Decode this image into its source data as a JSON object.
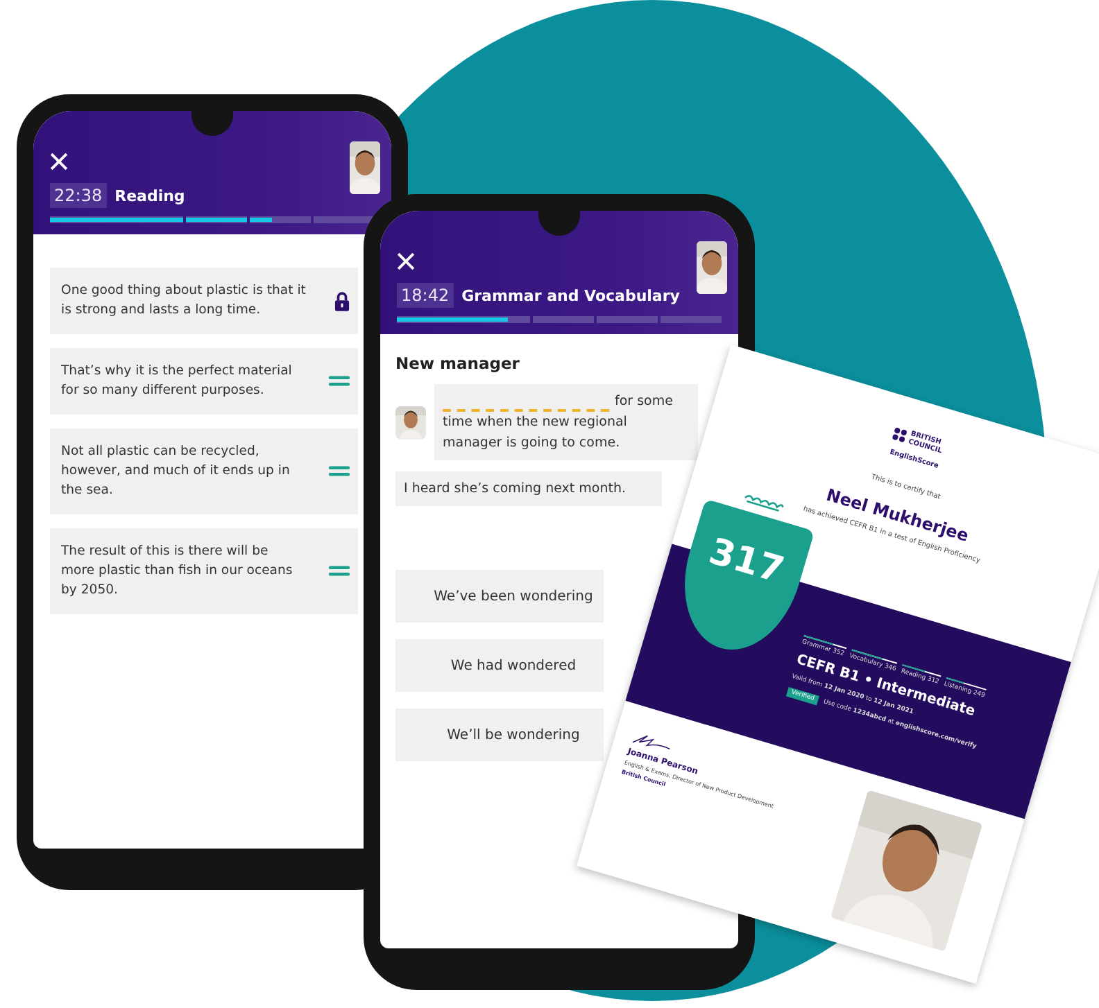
{
  "reading_phone": {
    "timer": "22:38",
    "title": "Reading",
    "progress": [
      {
        "level": 1
      },
      {
        "level": 1
      },
      {
        "level": 0.35
      },
      {
        "level": 0
      }
    ],
    "items": [
      {
        "text": "One good thing about plastic is that it is strong and lasts a long time.",
        "kind": "locked"
      },
      {
        "text": "That’s why it is the perfect material for so many different purposes.",
        "kind": "draggable"
      },
      {
        "text": "Not all plastic can be recycled, however, and much of it ends up in the sea.",
        "kind": "draggable"
      },
      {
        "text": "The result of this is there will be more plastic than fish in our oceans by 2050.",
        "kind": "draggable"
      }
    ]
  },
  "grammar_phone": {
    "timer": "18:42",
    "title": "Grammar and Vocabulary",
    "progress": [
      {
        "level": 0.83
      },
      {
        "level": 0
      },
      {
        "level": 0
      },
      {
        "level": 0
      }
    ],
    "heading": "New manager",
    "messages": [
      {
        "after_gap": "for some",
        "text": "time when the new regional manager is going to come.",
        "kind": "gap"
      },
      {
        "text": "I heard she’s coming next month.",
        "kind": "reply"
      }
    ],
    "options": [
      "We’ve been wondering",
      "We had wondered",
      "We’ll be wondering"
    ]
  },
  "certificate": {
    "logo": "BRITISH COUNCIL",
    "brand": "EnglishScore",
    "intro": "This is to certify that",
    "name": "Neel Mukherjee",
    "achievement": "has achieved CEFR B1 in a test of English Proficiency",
    "score": "317",
    "skills": [
      {
        "label": "Grammar 352",
        "level": 0.7
      },
      {
        "label": "Vocabulary 346",
        "level": 0.68
      },
      {
        "label": "Reading 312",
        "level": 0.6
      },
      {
        "label": "Listening 249",
        "level": 0.45
      }
    ],
    "level_title": "CEFR B1 • Intermediate",
    "validity": "Valid from **12 Jan 2020** to **12 Jan 2021**",
    "verified": "Verified",
    "code": "Use code **1234abcd** at **englishscore.com/verify**",
    "signatory": "Joanna Pearson",
    "role": "English & Exams, Director of New Product Development",
    "org": "British Council"
  }
}
